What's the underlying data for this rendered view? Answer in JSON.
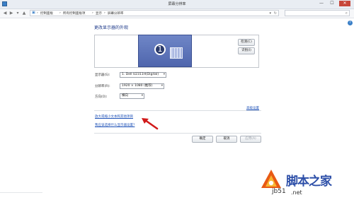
{
  "window": {
    "title": "屏幕分辨率",
    "controls": [
      "—",
      "☐",
      "✕"
    ]
  },
  "nav": {
    "breadcrumb": [
      "控制面板",
      "所有控制面板项",
      "显示",
      "屏幕分辨率"
    ],
    "separator": "›"
  },
  "main": {
    "heading": "更改显示器的外观",
    "monitor_number": "1",
    "detect_button": "检测(C)",
    "identify_button": "识别(I)",
    "display_label": "显示器(S):",
    "display_value": "1. Dell U2311H(Digital)",
    "resolution_label": "分辨率(R):",
    "resolution_value": "1920 × 1080 (推荐)",
    "orientation_label": "方向(O):",
    "orientation_value": "横向",
    "advanced_link": "高级设置",
    "link_text_size": "放大或缩小文本和其他项目",
    "link_help": "我应该选择什么显示器设置?",
    "ok_button": "确定",
    "cancel_button": "取消",
    "apply_button": "应用(A)"
  },
  "watermark": {
    "brand": "脚本之家",
    "site_a": "jb51",
    "site_b": ".net"
  },
  "colors": {
    "accent": "#1f52b8",
    "monitor": "#5a70b5",
    "arrow": "#d11a1a",
    "watermark": "#2d4fa8"
  }
}
